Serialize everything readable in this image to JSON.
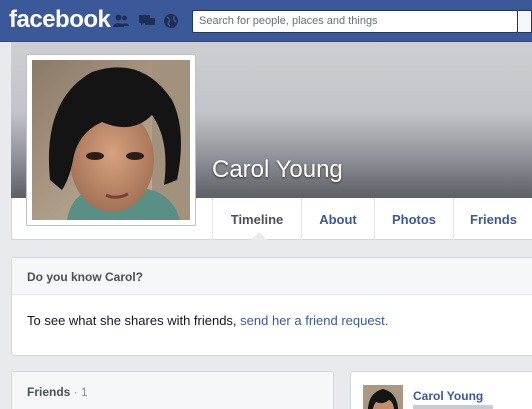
{
  "header": {
    "logo": "facebook",
    "search_placeholder": "Search for people, places and things",
    "icons": [
      "friend-requests-icon",
      "messages-icon",
      "notifications-globe-icon"
    ]
  },
  "profile": {
    "name": "Carol Young",
    "tabs": [
      {
        "label": "Timeline"
      },
      {
        "label": "About"
      },
      {
        "label": "Photos"
      },
      {
        "label": "Friends"
      }
    ]
  },
  "know": {
    "title": "Do you know Carol?",
    "body_text": "To see what she shares with friends, ",
    "link_text": "send her a friend request."
  },
  "friends": {
    "title": "Friends",
    "count": " · 1"
  },
  "post": {
    "author": "Carol Young"
  },
  "colors": {
    "brand": "#3b5998",
    "background": "#e9eaed"
  }
}
